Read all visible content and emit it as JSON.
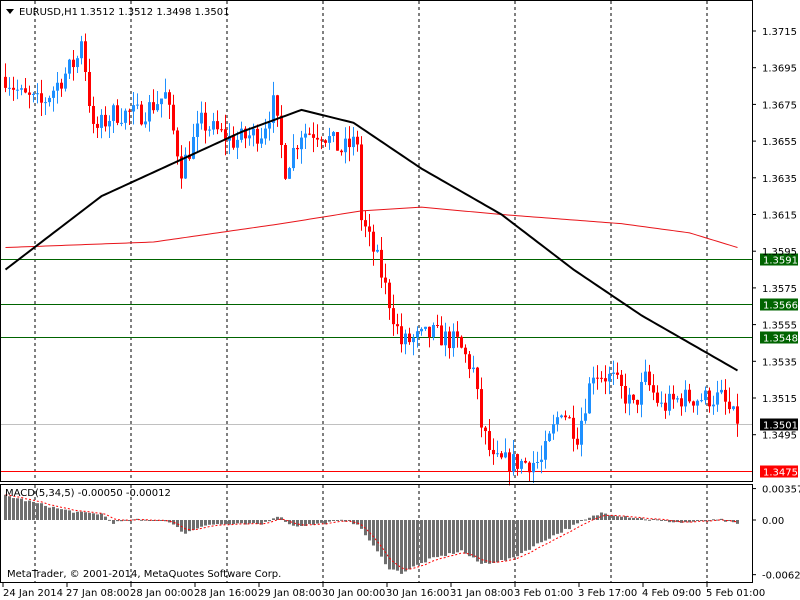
{
  "header": {
    "symbol": "EURUSD,H1",
    "ohlc": "1.3512 1.3512 1.3498 1.3501"
  },
  "indicator": {
    "label": "MACD(5,34,5) -0.00050 -0.00012"
  },
  "copyright": "MetaTrader, © 2001-2014, MetaQuotes Software Corp.",
  "colors": {
    "bull": "#1e90ff",
    "bear": "#ff0000",
    "ma_fast": "#000000",
    "ma_slow": "#e8141a",
    "level": "#006400",
    "bid": "#000000",
    "stop": "#ff0000"
  },
  "chart_data": [
    {
      "type": "candlestick",
      "price_ticks": [
        "1.3715",
        "1.3695",
        "1.3675",
        "1.3655",
        "1.3635",
        "1.3615",
        "1.3595",
        "1.3575",
        "1.3555",
        "1.3535",
        "1.3515",
        "1.3495"
      ],
      "x_ticks": [
        "24 Jan 2014",
        "27 Jan 08:00",
        "28 Jan 00:00",
        "28 Jan 16:00",
        "29 Jan 08:00",
        "30 Jan 00:00",
        "30 Jan 16:00",
        "31 Jan 08:00",
        "3 Feb 01:00",
        "3 Feb 17:00",
        "4 Feb 09:00",
        "5 Feb 01:00"
      ],
      "bars": 184,
      "close_path": [
        [
          0,
          1.369
        ],
        [
          4,
          1.368
        ],
        [
          9,
          1.3675
        ],
        [
          18,
          1.37
        ],
        [
          19,
          1.3712
        ],
        [
          22,
          1.366
        ],
        [
          27,
          1.367
        ],
        [
          34,
          1.367
        ],
        [
          40,
          1.368
        ],
        [
          44,
          1.364
        ],
        [
          49,
          1.3665
        ],
        [
          57,
          1.3655
        ],
        [
          64,
          1.366
        ],
        [
          67,
          1.3675
        ],
        [
          70,
          1.364
        ],
        [
          74,
          1.366
        ],
        [
          79,
          1.366
        ],
        [
          84,
          1.365
        ],
        [
          88,
          1.3655
        ],
        [
          89,
          1.3612
        ],
        [
          93,
          1.359
        ],
        [
          97,
          1.356
        ],
        [
          99,
          1.3545
        ],
        [
          107,
          1.355
        ],
        [
          113,
          1.3545
        ],
        [
          117,
          1.353
        ],
        [
          119,
          1.35
        ],
        [
          122,
          1.348
        ],
        [
          127,
          1.348
        ],
        [
          134,
          1.348
        ],
        [
          139,
          1.351
        ],
        [
          143,
          1.3495
        ],
        [
          147,
          1.353
        ],
        [
          152,
          1.3525
        ],
        [
          157,
          1.351
        ],
        [
          160,
          1.3525
        ],
        [
          164,
          1.351
        ],
        [
          169,
          1.3515
        ],
        [
          174,
          1.3515
        ],
        [
          179,
          1.3515
        ],
        [
          183,
          1.3501
        ]
      ],
      "ma_fast": [
        [
          0,
          1.3585
        ],
        [
          24,
          1.3625
        ],
        [
          59,
          1.366
        ],
        [
          74,
          1.3672
        ],
        [
          87,
          1.3665
        ],
        [
          104,
          1.364
        ],
        [
          124,
          1.3615
        ],
        [
          142,
          1.3585
        ],
        [
          159,
          1.356
        ],
        [
          183,
          1.353
        ]
      ],
      "ma_slow": [
        [
          0,
          1.3597
        ],
        [
          37,
          1.36
        ],
        [
          69,
          1.361
        ],
        [
          89,
          1.3617
        ],
        [
          104,
          1.3619
        ],
        [
          124,
          1.3615
        ],
        [
          154,
          1.361
        ],
        [
          171,
          1.3605
        ],
        [
          183,
          1.3597
        ]
      ],
      "levels": [
        {
          "price": "1.3591",
          "kind": "level"
        },
        {
          "price": "1.3566",
          "kind": "level"
        },
        {
          "price": "1.3548",
          "kind": "level"
        },
        {
          "price": "1.3501",
          "kind": "bid"
        },
        {
          "price": "1.3475",
          "kind": "stop"
        }
      ]
    },
    {
      "type": "bar",
      "name": "MACD(5,34,5)",
      "y_ticks": [
        "0.00357",
        "0.00",
        "-0.00621"
      ],
      "histogram": [
        [
          0,
          0.0028
        ],
        [
          14,
          0.0012
        ],
        [
          19,
          0.0008
        ],
        [
          24,
          0.0007
        ],
        [
          27,
          -0.0003
        ],
        [
          32,
          0.0
        ],
        [
          40,
          0.0
        ],
        [
          45,
          -0.0015
        ],
        [
          50,
          -0.0005
        ],
        [
          64,
          -0.0005
        ],
        [
          68,
          0.0005
        ],
        [
          72,
          -0.0007
        ],
        [
          79,
          -0.0004
        ],
        [
          86,
          0.0
        ],
        [
          89,
          -0.001
        ],
        [
          92,
          -0.003
        ],
        [
          96,
          -0.0055
        ],
        [
          99,
          -0.006
        ],
        [
          106,
          -0.0045
        ],
        [
          114,
          -0.0035
        ],
        [
          119,
          -0.005
        ],
        [
          126,
          -0.0045
        ],
        [
          136,
          -0.002
        ],
        [
          145,
          0.0
        ],
        [
          149,
          0.0008
        ],
        [
          159,
          0.0002
        ],
        [
          169,
          -0.0003
        ],
        [
          179,
          0.0
        ],
        [
          183,
          -0.0005
        ]
      ],
      "signal": "smoothed histogram (period 5)"
    }
  ]
}
